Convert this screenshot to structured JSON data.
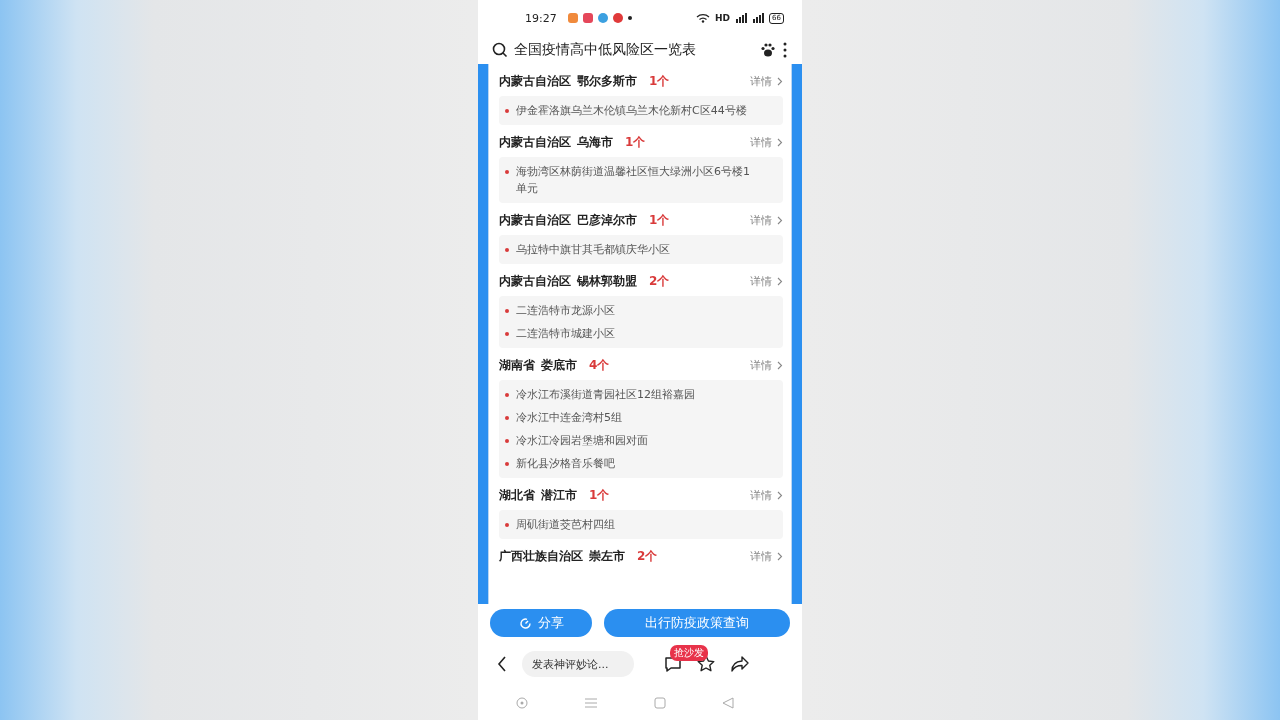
{
  "status_bar": {
    "time": "19:27",
    "network": "HD",
    "battery": "66"
  },
  "search": {
    "query": "全国疫情高中低风险区一览表"
  },
  "groups": [
    {
      "province": "内蒙古自治区",
      "city": "鄂尔多斯市",
      "count": "1个",
      "link": "详情",
      "items": [
        "伊金霍洛旗乌兰木伦镇乌兰木伦新村C区44号楼"
      ]
    },
    {
      "province": "内蒙古自治区",
      "city": "乌海市",
      "count": "1个",
      "link": "详情",
      "items": [
        "海勃湾区林荫街道温馨社区恒大绿洲小区6号楼1单元"
      ]
    },
    {
      "province": "内蒙古自治区",
      "city": "巴彦淖尔市",
      "count": "1个",
      "link": "详情",
      "items": [
        "乌拉特中旗甘其毛都镇庆华小区"
      ]
    },
    {
      "province": "内蒙古自治区",
      "city": "锡林郭勒盟",
      "count": "2个",
      "link": "详情",
      "items": [
        "二连浩特市龙源小区",
        "二连浩特市城建小区"
      ]
    },
    {
      "province": "湖南省",
      "city": "娄底市",
      "count": "4个",
      "link": "详情",
      "items": [
        "冷水江布溪街道青园社区12组裕嘉园",
        "冷水江中连金湾村5组",
        "冷水江冷园岩堡塘和园对面",
        "新化县汐格音乐餐吧"
      ]
    },
    {
      "province": "湖北省",
      "city": "潜江市",
      "count": "1个",
      "link": "详情",
      "items": [
        "周矶街道茭芭村四组"
      ]
    },
    {
      "province": "广西壮族自治区",
      "city": "崇左市",
      "count": "2个",
      "link": "详情"
    }
  ],
  "actions": {
    "share": "分享",
    "policy": "出行防疫政策查询"
  },
  "comment": {
    "placeholder": "发表神评妙论...",
    "badge": "抢沙发"
  }
}
